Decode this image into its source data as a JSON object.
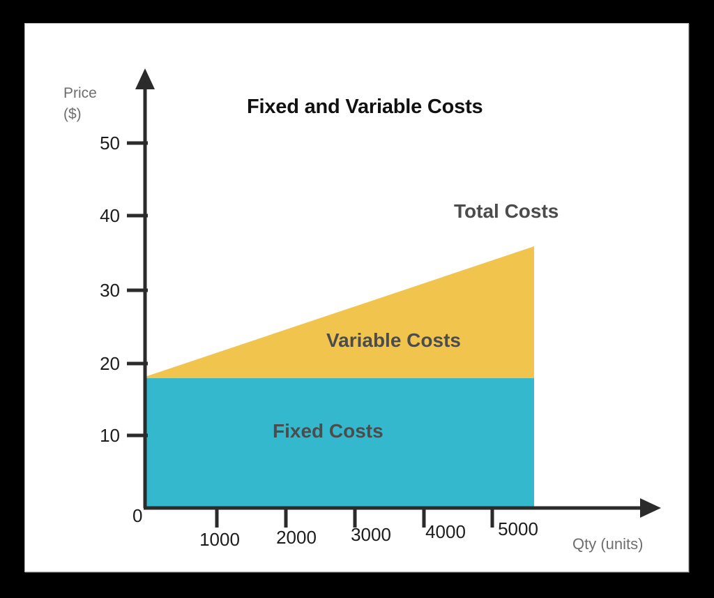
{
  "chart_data": {
    "type": "area",
    "title": "Fixed and Variable Costs",
    "xlabel": "Qty (units)",
    "ylabel": "Price\n($)",
    "xlim": [
      0,
      5270
    ],
    "ylim": [
      0,
      55
    ],
    "grid": false,
    "legend_position": "inline-labels",
    "x_ticks": [
      1000,
      2000,
      3000,
      4000,
      5000
    ],
    "x_tick_labels": [
      "1000",
      "2000",
      "3000",
      "4000",
      "5000"
    ],
    "y_ticks": [
      10,
      20,
      30,
      40,
      50
    ],
    "y_tick_labels": [
      "10",
      "20",
      "30",
      "40",
      "50"
    ],
    "origin_label": "0",
    "series": [
      {
        "name": "Fixed Costs",
        "color": "#34b8cd",
        "x": [
          0,
          5270
        ],
        "values": [
          18,
          18
        ],
        "label": "Fixed Costs"
      },
      {
        "name": "Variable Costs",
        "color": "#f1c44e",
        "x": [
          0,
          5270
        ],
        "values": [
          0,
          18
        ],
        "label": "Variable Costs"
      },
      {
        "name": "Total Costs",
        "color": "#f1c44e",
        "x": [
          0,
          5270
        ],
        "values": [
          18,
          36
        ],
        "label": "Total Costs"
      }
    ],
    "annotations": [
      {
        "text": "Total Costs",
        "x": 4600,
        "y": 41
      },
      {
        "text": "Variable Costs",
        "x": 2900,
        "y": 25
      },
      {
        "text": "Fixed Costs",
        "x": 2200,
        "y": 11
      }
    ]
  },
  "chart": {
    "title": "Fixed and Variable Costs",
    "y_axis_title": "Price\n($)",
    "x_axis_title": "Qty (units)",
    "origin_label": "0",
    "y_tick_labels": [
      "50",
      "40",
      "30",
      "20",
      "10"
    ],
    "x_tick_labels": [
      "1000",
      "2000",
      "3000",
      "4000",
      "5000"
    ],
    "labels": {
      "total_costs": "Total Costs",
      "variable_costs": "Variable Costs",
      "fixed_costs": "Fixed Costs"
    },
    "colors": {
      "fixed_costs": "#34b8cd",
      "variable_costs": "#f1c44e",
      "axis": "#2b2b2b",
      "axis_title": "#6e6e6e",
      "series_label": "#4c4c4c",
      "title": "#111111",
      "panel_background": "#ffffff",
      "page_background": "#000000"
    }
  }
}
